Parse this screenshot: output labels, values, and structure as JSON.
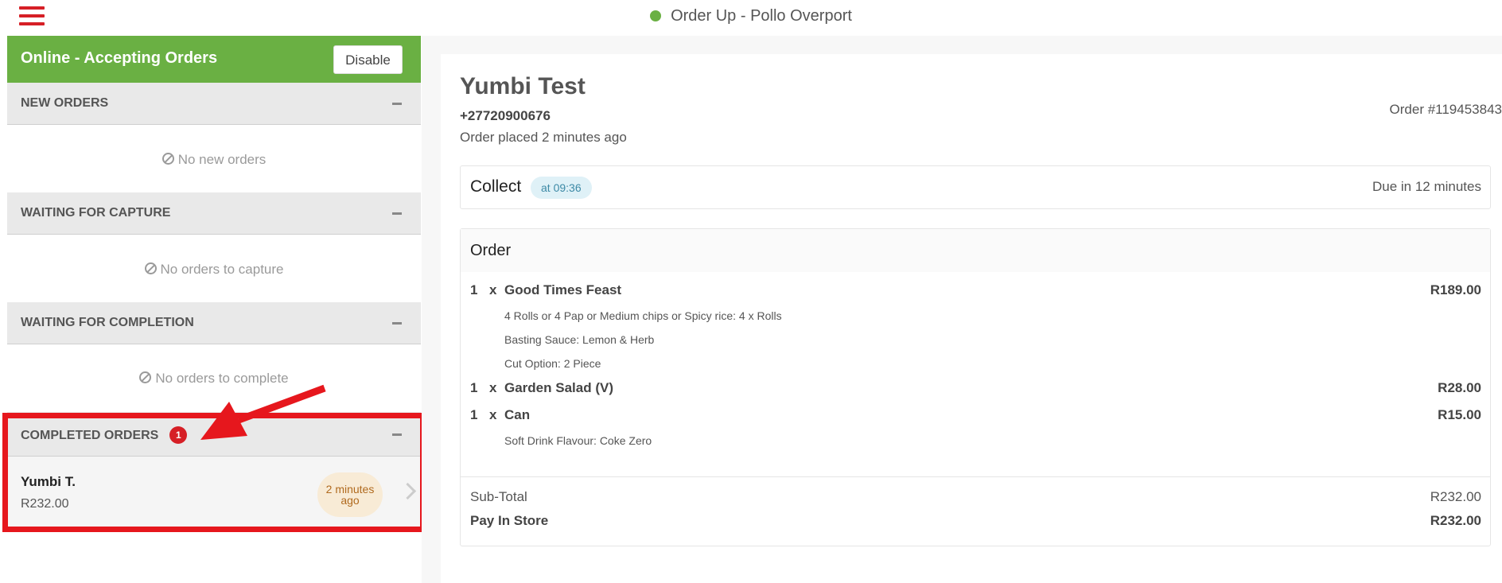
{
  "header": {
    "title": "Order Up - Pollo Overport",
    "status_color": "#6ab043",
    "menu_icon": "hamburger-menu-icon"
  },
  "sidebar": {
    "online_status": "Online - Accepting Orders",
    "disable_label": "Disable",
    "sections": {
      "new_orders": {
        "title": "NEW ORDERS",
        "empty": "No new orders"
      },
      "waiting_capture": {
        "title": "WAITING FOR CAPTURE",
        "empty": "No orders to capture"
      },
      "waiting_completion": {
        "title": "WAITING FOR COMPLETION",
        "empty": "No orders to complete"
      },
      "completed": {
        "title": "COMPLETED ORDERS",
        "badge": "1",
        "order": {
          "name": "Yumbi T.",
          "amount": "R232.00",
          "time": "2 minutes ago"
        }
      }
    }
  },
  "order": {
    "customer_name": "Yumbi Test",
    "phone": "+27720900676",
    "placed": "Order placed 2 minutes ago",
    "order_number": "Order #119453843",
    "collect_label": "Collect",
    "collect_time": "at 09:36",
    "due": "Due in 12 minutes",
    "section_title": "Order",
    "items": [
      {
        "qty": "1",
        "x": "x",
        "name": "Good Times Feast",
        "price": "R189.00",
        "modifiers": [
          "4 Rolls or 4 Pap or Medium chips or Spicy rice: 4 x Rolls",
          "Basting Sauce: Lemon & Herb",
          "Cut Option: 2 Piece"
        ]
      },
      {
        "qty": "1",
        "x": "x",
        "name": "Garden Salad (V)",
        "price": "R28.00",
        "modifiers": []
      },
      {
        "qty": "1",
        "x": "x",
        "name": "Can",
        "price": "R15.00",
        "modifiers": [
          "Soft Drink Flavour: Coke Zero"
        ]
      }
    ],
    "subtotal_label": "Sub-Total",
    "subtotal": "R232.00",
    "payment_label": "Pay In Store",
    "payment_total": "R232.00"
  },
  "colors": {
    "brand_red": "#d61f26",
    "online_green": "#6ab043",
    "annotation_red": "#e6171d"
  }
}
